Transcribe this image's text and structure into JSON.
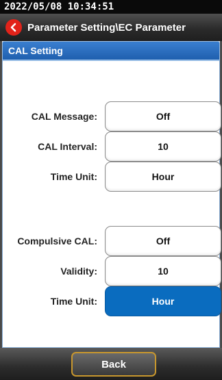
{
  "status": {
    "datetime": "2022/05/08  10:34:51"
  },
  "titlebar": {
    "back_icon": "back-arrow-icon",
    "title": "Parameter Setting\\EC Parameter"
  },
  "section": {
    "title": "CAL Setting"
  },
  "fields": {
    "cal_message": {
      "label": "CAL Message:",
      "value": "Off"
    },
    "cal_interval": {
      "label": "CAL Interval:",
      "value": "10"
    },
    "time_unit_1": {
      "label": "Time Unit:",
      "value": "Hour"
    },
    "compulsive_cal": {
      "label": "Compulsive CAL:",
      "value": "Off"
    },
    "validity": {
      "label": "Validity:",
      "value": "10"
    },
    "time_unit_2": {
      "label": "Time Unit:",
      "value": "Hour"
    }
  },
  "footer": {
    "back_label": "Back"
  },
  "colors": {
    "accent": "#0a6cbf",
    "back_icon": "#e2231a",
    "button_border": "#c8972e"
  }
}
